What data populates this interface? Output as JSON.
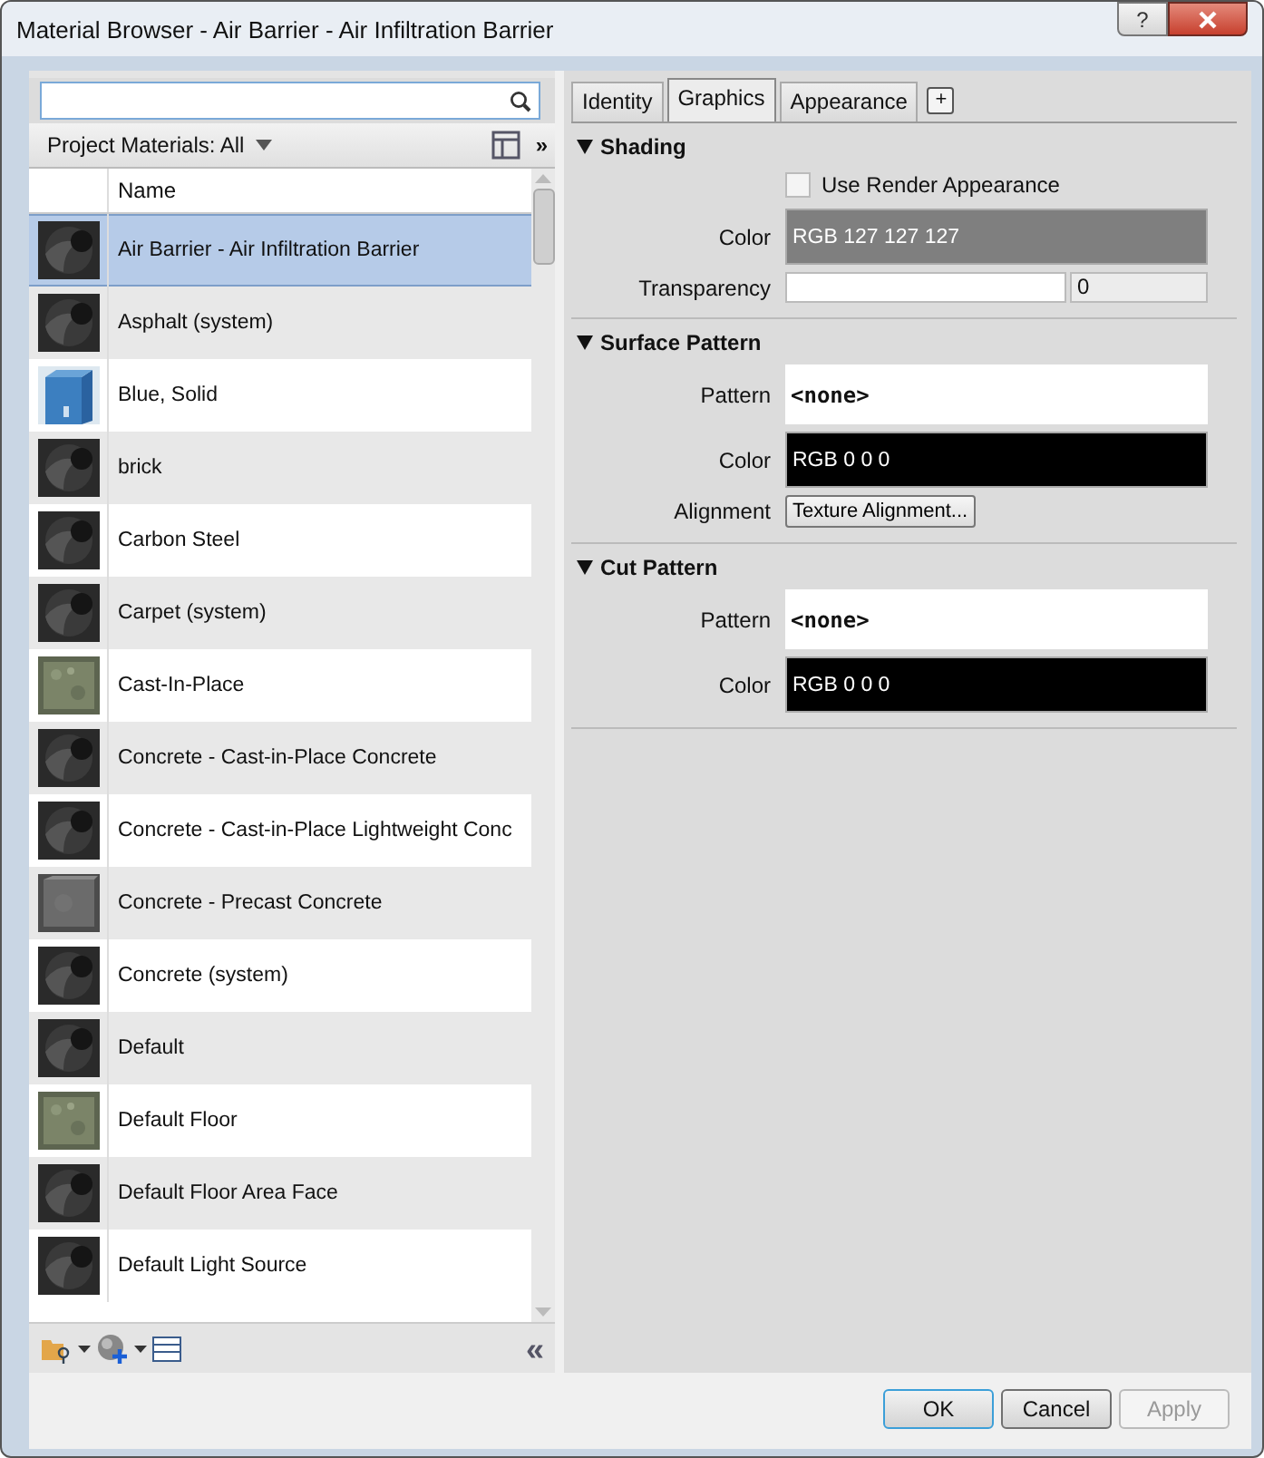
{
  "window": {
    "title": "Material Browser - Air Barrier - Air Infiltration Barrier",
    "help": "?"
  },
  "library": {
    "label": "Project Materials: All",
    "more": "»"
  },
  "table": {
    "columns": [
      "Name"
    ],
    "rows": [
      {
        "name": "Air Barrier - Air Infiltration Barrier",
        "kind": "sphere",
        "selected": true
      },
      {
        "name": "Asphalt (system)",
        "kind": "sphere",
        "selected": false
      },
      {
        "name": "Blue, Solid",
        "kind": "blue",
        "selected": false
      },
      {
        "name": "brick",
        "kind": "sphere",
        "selected": false
      },
      {
        "name": "Carbon Steel",
        "kind": "sphere",
        "selected": false
      },
      {
        "name": "Carpet (system)",
        "kind": "sphere",
        "selected": false
      },
      {
        "name": "Cast-In-Place",
        "kind": "stone",
        "selected": false
      },
      {
        "name": "Concrete - Cast-in-Place Concrete",
        "kind": "sphere",
        "selected": false
      },
      {
        "name": "Concrete - Cast-in-Place Lightweight Conc",
        "kind": "sphere",
        "selected": false
      },
      {
        "name": "Concrete - Precast Concrete",
        "kind": "grey",
        "selected": false
      },
      {
        "name": "Concrete (system)",
        "kind": "sphere",
        "selected": false
      },
      {
        "name": "Default",
        "kind": "sphere",
        "selected": false
      },
      {
        "name": "Default Floor",
        "kind": "stone",
        "selected": false
      },
      {
        "name": "Default Floor Area Face",
        "kind": "sphere",
        "selected": false
      },
      {
        "name": "Default Light Source",
        "kind": "sphere",
        "selected": false
      }
    ]
  },
  "collapse": "«",
  "tabs": [
    {
      "label": "Identity",
      "selected": false
    },
    {
      "label": "Graphics",
      "selected": true
    },
    {
      "label": "Appearance",
      "selected": false
    }
  ],
  "add_tab": "+",
  "sections": [
    {
      "title": "Shading",
      "expanded": true,
      "fields": [
        {
          "kind": "checkbox",
          "text": "Use Render Appearance",
          "checked": false
        },
        {
          "kind": "color",
          "label": "Color",
          "value": "RGB 127 127 127",
          "color": "#7f7f7f"
        },
        {
          "kind": "number",
          "label": "Transparency",
          "value": "0"
        }
      ]
    },
    {
      "title": "Surface Pattern",
      "expanded": true,
      "fields": [
        {
          "kind": "pattern",
          "label": "Pattern",
          "value": "<none>"
        },
        {
          "kind": "color",
          "label": "Color",
          "value": "RGB 0 0 0",
          "color": "#000000"
        },
        {
          "kind": "button",
          "label": "Alignment",
          "value": "Texture Alignment..."
        }
      ]
    },
    {
      "title": "Cut Pattern",
      "expanded": true,
      "fields": [
        {
          "kind": "pattern",
          "label": "Pattern",
          "value": "<none>"
        },
        {
          "kind": "color",
          "label": "Color",
          "value": "RGB 0 0 0",
          "color": "#000000"
        }
      ]
    }
  ],
  "buttons": [
    {
      "label": "OK",
      "kind": "default",
      "disabled": false
    },
    {
      "label": "Cancel",
      "kind": "normal",
      "disabled": false
    },
    {
      "label": "Apply",
      "kind": "normal",
      "disabled": true
    }
  ]
}
